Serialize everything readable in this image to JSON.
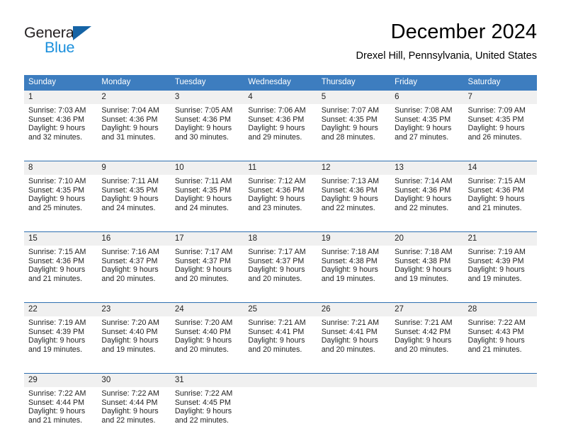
{
  "brand": {
    "name_top": "General",
    "name_bottom": "Blue",
    "triangle_color": "#1563a5",
    "blue_color": "#1a8fdc",
    "dark_color": "#231f20"
  },
  "header": {
    "title": "December 2024",
    "location": "Drexel Hill, Pennsylvania, United States"
  },
  "theme": {
    "header_bar_color": "#3d7dbf",
    "daynum_row_color": "#f0f0f0",
    "row_divider_color": "#2f6fb0",
    "text_color": "#222222"
  },
  "calendar": {
    "weekday_headers": [
      "Sunday",
      "Monday",
      "Tuesday",
      "Wednesday",
      "Thursday",
      "Friday",
      "Saturday"
    ],
    "weeks": [
      {
        "days": [
          {
            "num": "1",
            "sunrise": "Sunrise: 7:03 AM",
            "sunset": "Sunset: 4:36 PM",
            "daylight1": "Daylight: 9 hours",
            "daylight2": "and 32 minutes."
          },
          {
            "num": "2",
            "sunrise": "Sunrise: 7:04 AM",
            "sunset": "Sunset: 4:36 PM",
            "daylight1": "Daylight: 9 hours",
            "daylight2": "and 31 minutes."
          },
          {
            "num": "3",
            "sunrise": "Sunrise: 7:05 AM",
            "sunset": "Sunset: 4:36 PM",
            "daylight1": "Daylight: 9 hours",
            "daylight2": "and 30 minutes."
          },
          {
            "num": "4",
            "sunrise": "Sunrise: 7:06 AM",
            "sunset": "Sunset: 4:36 PM",
            "daylight1": "Daylight: 9 hours",
            "daylight2": "and 29 minutes."
          },
          {
            "num": "5",
            "sunrise": "Sunrise: 7:07 AM",
            "sunset": "Sunset: 4:35 PM",
            "daylight1": "Daylight: 9 hours",
            "daylight2": "and 28 minutes."
          },
          {
            "num": "6",
            "sunrise": "Sunrise: 7:08 AM",
            "sunset": "Sunset: 4:35 PM",
            "daylight1": "Daylight: 9 hours",
            "daylight2": "and 27 minutes."
          },
          {
            "num": "7",
            "sunrise": "Sunrise: 7:09 AM",
            "sunset": "Sunset: 4:35 PM",
            "daylight1": "Daylight: 9 hours",
            "daylight2": "and 26 minutes."
          }
        ]
      },
      {
        "days": [
          {
            "num": "8",
            "sunrise": "Sunrise: 7:10 AM",
            "sunset": "Sunset: 4:35 PM",
            "daylight1": "Daylight: 9 hours",
            "daylight2": "and 25 minutes."
          },
          {
            "num": "9",
            "sunrise": "Sunrise: 7:11 AM",
            "sunset": "Sunset: 4:35 PM",
            "daylight1": "Daylight: 9 hours",
            "daylight2": "and 24 minutes."
          },
          {
            "num": "10",
            "sunrise": "Sunrise: 7:11 AM",
            "sunset": "Sunset: 4:35 PM",
            "daylight1": "Daylight: 9 hours",
            "daylight2": "and 24 minutes."
          },
          {
            "num": "11",
            "sunrise": "Sunrise: 7:12 AM",
            "sunset": "Sunset: 4:36 PM",
            "daylight1": "Daylight: 9 hours",
            "daylight2": "and 23 minutes."
          },
          {
            "num": "12",
            "sunrise": "Sunrise: 7:13 AM",
            "sunset": "Sunset: 4:36 PM",
            "daylight1": "Daylight: 9 hours",
            "daylight2": "and 22 minutes."
          },
          {
            "num": "13",
            "sunrise": "Sunrise: 7:14 AM",
            "sunset": "Sunset: 4:36 PM",
            "daylight1": "Daylight: 9 hours",
            "daylight2": "and 22 minutes."
          },
          {
            "num": "14",
            "sunrise": "Sunrise: 7:15 AM",
            "sunset": "Sunset: 4:36 PM",
            "daylight1": "Daylight: 9 hours",
            "daylight2": "and 21 minutes."
          }
        ]
      },
      {
        "days": [
          {
            "num": "15",
            "sunrise": "Sunrise: 7:15 AM",
            "sunset": "Sunset: 4:36 PM",
            "daylight1": "Daylight: 9 hours",
            "daylight2": "and 21 minutes."
          },
          {
            "num": "16",
            "sunrise": "Sunrise: 7:16 AM",
            "sunset": "Sunset: 4:37 PM",
            "daylight1": "Daylight: 9 hours",
            "daylight2": "and 20 minutes."
          },
          {
            "num": "17",
            "sunrise": "Sunrise: 7:17 AM",
            "sunset": "Sunset: 4:37 PM",
            "daylight1": "Daylight: 9 hours",
            "daylight2": "and 20 minutes."
          },
          {
            "num": "18",
            "sunrise": "Sunrise: 7:17 AM",
            "sunset": "Sunset: 4:37 PM",
            "daylight1": "Daylight: 9 hours",
            "daylight2": "and 20 minutes."
          },
          {
            "num": "19",
            "sunrise": "Sunrise: 7:18 AM",
            "sunset": "Sunset: 4:38 PM",
            "daylight1": "Daylight: 9 hours",
            "daylight2": "and 19 minutes."
          },
          {
            "num": "20",
            "sunrise": "Sunrise: 7:18 AM",
            "sunset": "Sunset: 4:38 PM",
            "daylight1": "Daylight: 9 hours",
            "daylight2": "and 19 minutes."
          },
          {
            "num": "21",
            "sunrise": "Sunrise: 7:19 AM",
            "sunset": "Sunset: 4:39 PM",
            "daylight1": "Daylight: 9 hours",
            "daylight2": "and 19 minutes."
          }
        ]
      },
      {
        "days": [
          {
            "num": "22",
            "sunrise": "Sunrise: 7:19 AM",
            "sunset": "Sunset: 4:39 PM",
            "daylight1": "Daylight: 9 hours",
            "daylight2": "and 19 minutes."
          },
          {
            "num": "23",
            "sunrise": "Sunrise: 7:20 AM",
            "sunset": "Sunset: 4:40 PM",
            "daylight1": "Daylight: 9 hours",
            "daylight2": "and 19 minutes."
          },
          {
            "num": "24",
            "sunrise": "Sunrise: 7:20 AM",
            "sunset": "Sunset: 4:40 PM",
            "daylight1": "Daylight: 9 hours",
            "daylight2": "and 20 minutes."
          },
          {
            "num": "25",
            "sunrise": "Sunrise: 7:21 AM",
            "sunset": "Sunset: 4:41 PM",
            "daylight1": "Daylight: 9 hours",
            "daylight2": "and 20 minutes."
          },
          {
            "num": "26",
            "sunrise": "Sunrise: 7:21 AM",
            "sunset": "Sunset: 4:41 PM",
            "daylight1": "Daylight: 9 hours",
            "daylight2": "and 20 minutes."
          },
          {
            "num": "27",
            "sunrise": "Sunrise: 7:21 AM",
            "sunset": "Sunset: 4:42 PM",
            "daylight1": "Daylight: 9 hours",
            "daylight2": "and 20 minutes."
          },
          {
            "num": "28",
            "sunrise": "Sunrise: 7:22 AM",
            "sunset": "Sunset: 4:43 PM",
            "daylight1": "Daylight: 9 hours",
            "daylight2": "and 21 minutes."
          }
        ]
      },
      {
        "days": [
          {
            "num": "29",
            "sunrise": "Sunrise: 7:22 AM",
            "sunset": "Sunset: 4:44 PM",
            "daylight1": "Daylight: 9 hours",
            "daylight2": "and 21 minutes."
          },
          {
            "num": "30",
            "sunrise": "Sunrise: 7:22 AM",
            "sunset": "Sunset: 4:44 PM",
            "daylight1": "Daylight: 9 hours",
            "daylight2": "and 22 minutes."
          },
          {
            "num": "31",
            "sunrise": "Sunrise: 7:22 AM",
            "sunset": "Sunset: 4:45 PM",
            "daylight1": "Daylight: 9 hours",
            "daylight2": "and 22 minutes."
          },
          {
            "num": "",
            "sunrise": "",
            "sunset": "",
            "daylight1": "",
            "daylight2": ""
          },
          {
            "num": "",
            "sunrise": "",
            "sunset": "",
            "daylight1": "",
            "daylight2": ""
          },
          {
            "num": "",
            "sunrise": "",
            "sunset": "",
            "daylight1": "",
            "daylight2": ""
          },
          {
            "num": "",
            "sunrise": "",
            "sunset": "",
            "daylight1": "",
            "daylight2": ""
          }
        ]
      }
    ]
  }
}
